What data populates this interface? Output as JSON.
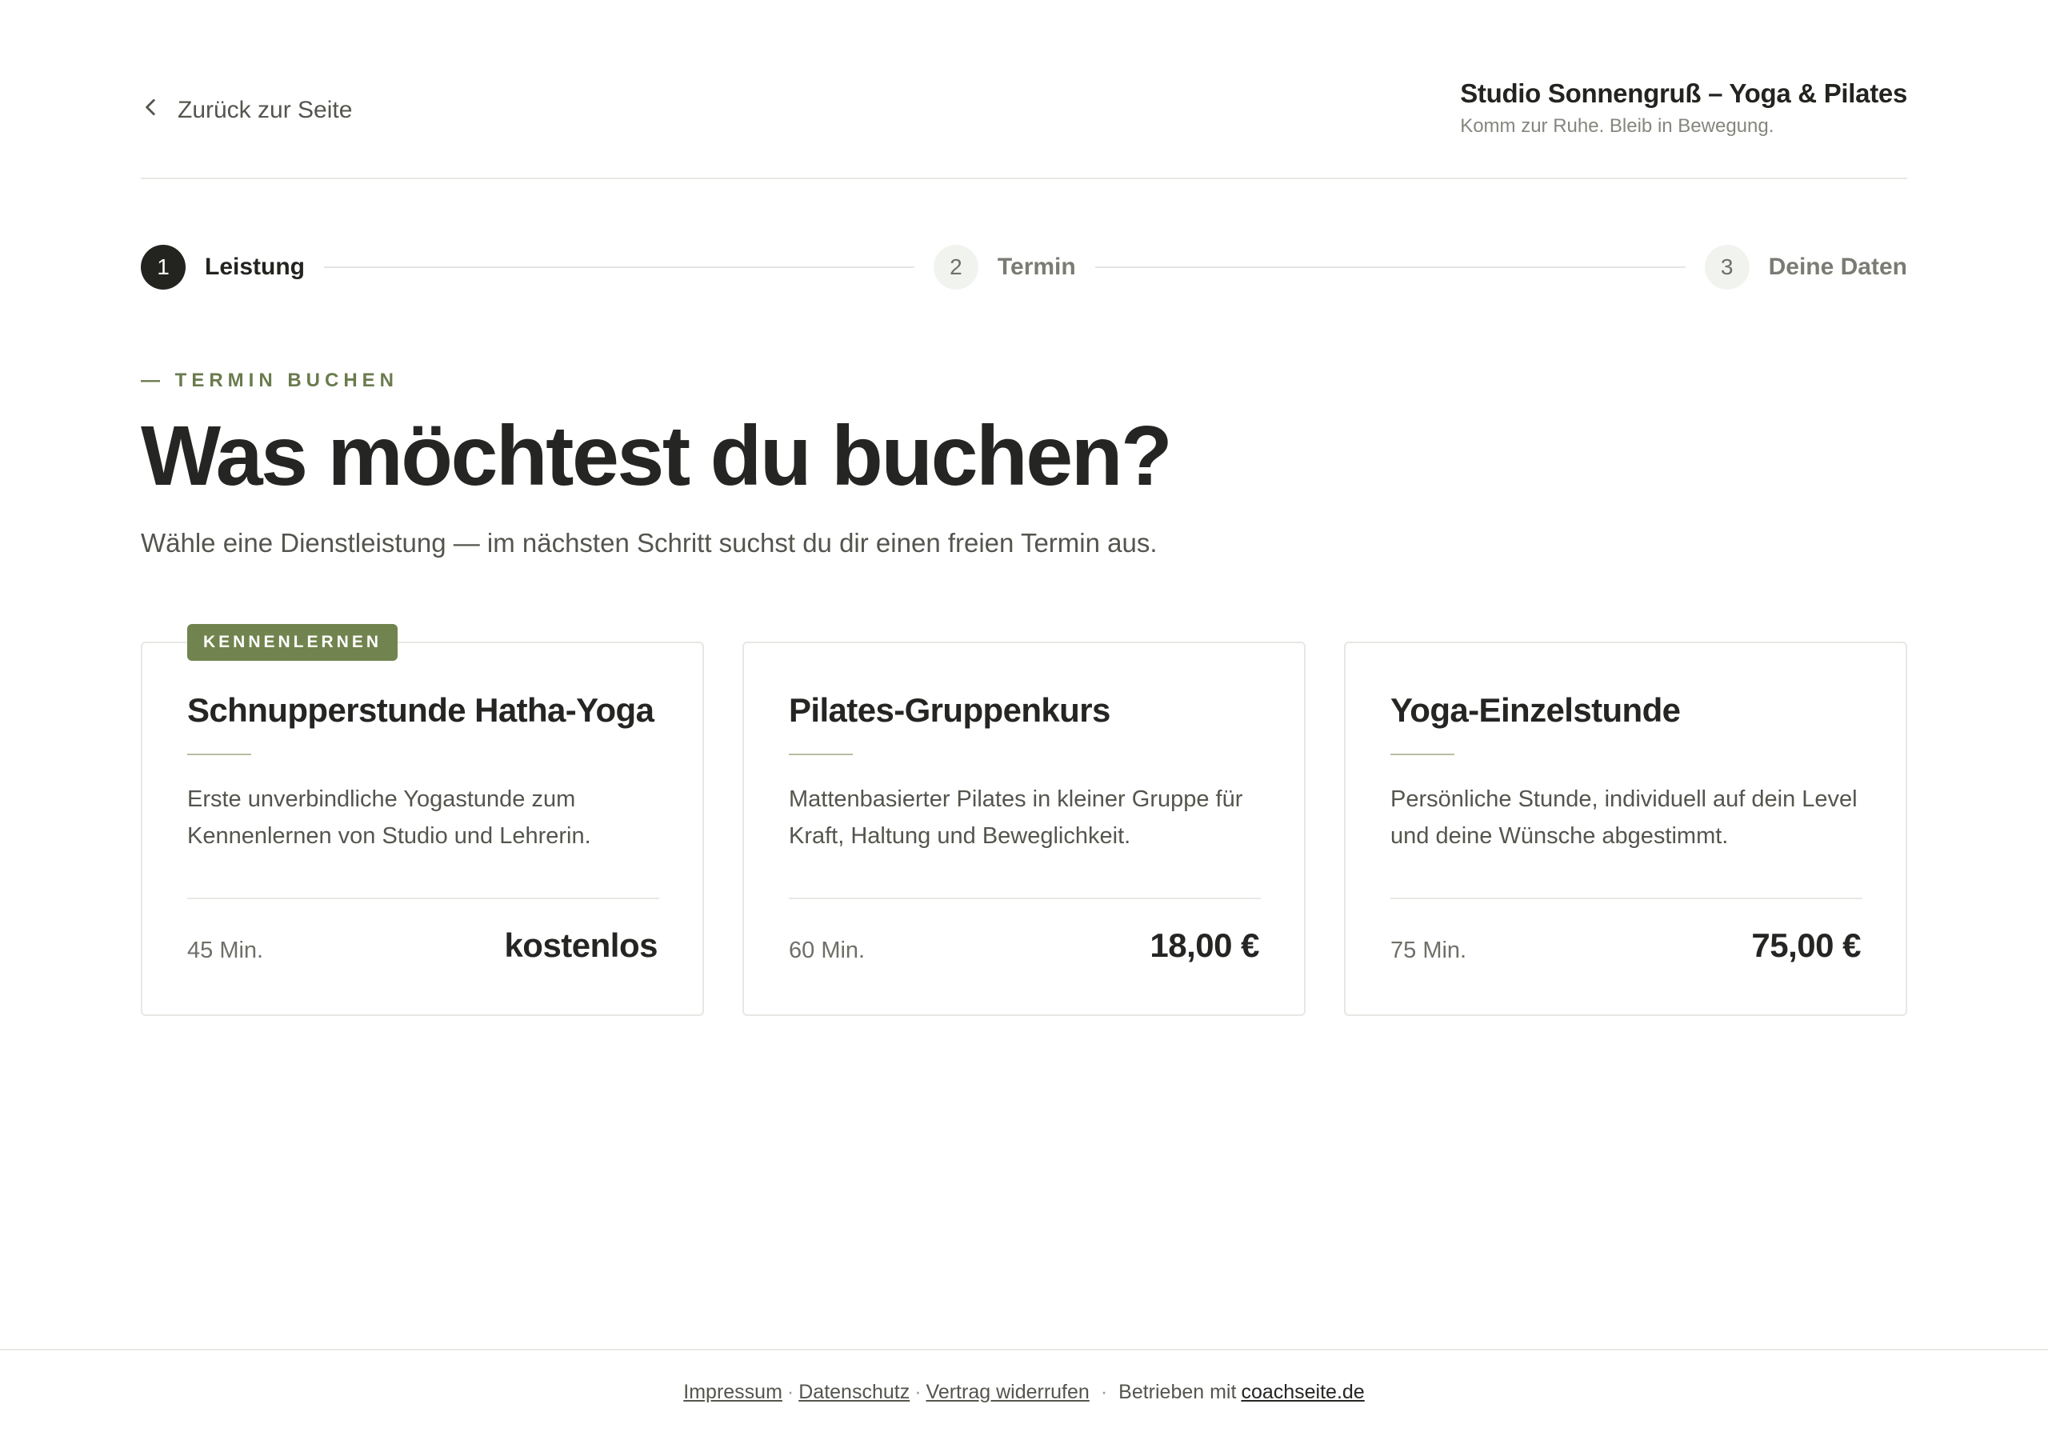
{
  "header": {
    "back_label": "Zurück zur Seite",
    "brand_name": "Studio Sonnengruß – Yoga & Pilates",
    "brand_tagline": "Komm zur Ruhe. Bleib in Bewegung."
  },
  "stepper": {
    "steps": [
      {
        "number": "1",
        "label": "Leistung"
      },
      {
        "number": "2",
        "label": "Termin"
      },
      {
        "number": "3",
        "label": "Deine Daten"
      }
    ]
  },
  "intro": {
    "eyebrow": "— TERMIN BUCHEN",
    "title": "Was möchtest du buchen?",
    "subtitle": "Wähle eine Dienstleistung — im nächsten Schritt suchst du dir einen freien Termin aus."
  },
  "services": [
    {
      "badge": "KENNENLERNEN",
      "title": "Schnupperstunde Hatha-Yoga",
      "description": "Erste unverbindliche Yogastunde zum Kennenlernen von Studio und Lehrerin.",
      "duration": "45 Min.",
      "price": "kostenlos"
    },
    {
      "title": "Pilates-Gruppenkurs",
      "description": "Mattenbasierter Pilates in kleiner Gruppe für Kraft, Haltung und Beweglichkeit.",
      "duration": "60 Min.",
      "price": "18,00 €"
    },
    {
      "title": "Yoga-Einzelstunde",
      "description": "Persönliche Stunde, individuell auf dein Level und deine Wünsche abgestimmt.",
      "duration": "75 Min.",
      "price": "75,00 €"
    }
  ],
  "footer": {
    "links": [
      "Impressum",
      "Datenschutz",
      "Vertrag widerrufen"
    ],
    "separator": "·",
    "powered_by": "Betrieben mit",
    "powered_link": "coachseite.de"
  },
  "colors": {
    "accent_olive": "#71834e",
    "eyebrow_olive": "#6a7b4e",
    "text_dark": "#252523",
    "border": "#e7e7e4"
  },
  "icons": {
    "back": "chevron-left-icon"
  }
}
